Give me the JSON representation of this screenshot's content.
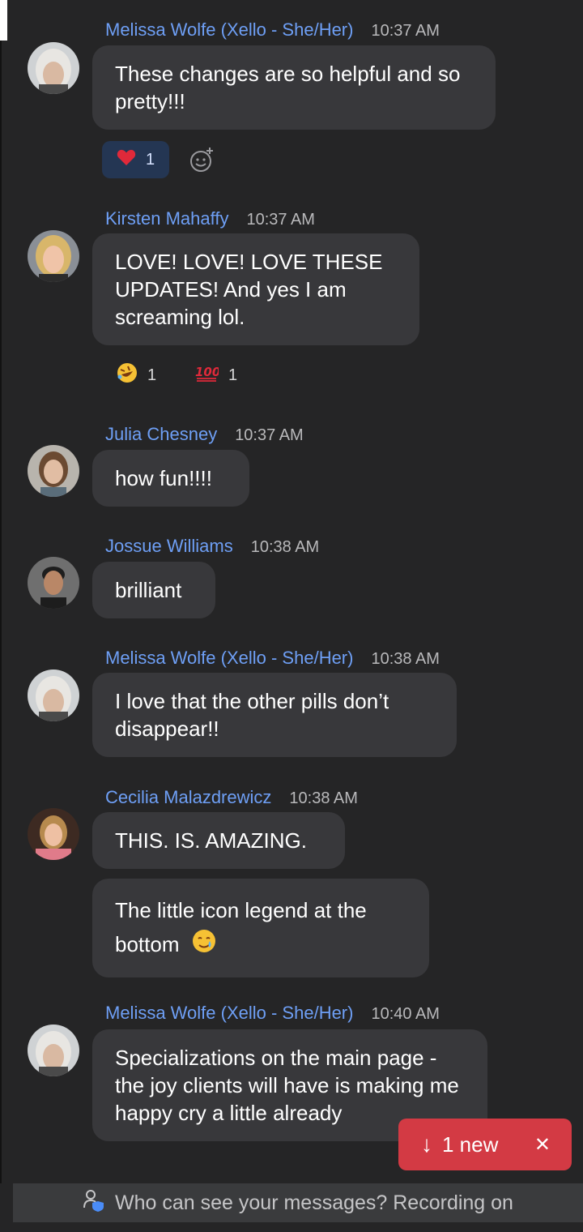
{
  "messages": [
    {
      "sender": "Melissa Wolfe (Xello - She/Her)",
      "time": "10:37 AM",
      "bubbles": [
        "These changes are so helpful and so pretty!!!"
      ],
      "reactions": [
        {
          "emoji": "heart",
          "count": "1"
        }
      ]
    },
    {
      "sender": "Kirsten Mahaffy",
      "time": "10:37 AM",
      "bubbles": [
        "LOVE! LOVE! LOVE THESE UPDATES! And yes I am screaming lol."
      ],
      "reactions": [
        {
          "emoji": "rolling-laughing",
          "count": "1"
        },
        {
          "emoji": "hundred",
          "count": "1"
        }
      ]
    },
    {
      "sender": "Julia Chesney",
      "time": "10:37 AM",
      "bubbles": [
        "how fun!!!!"
      ]
    },
    {
      "sender": "Jossue Williams",
      "time": "10:38 AM",
      "bubbles": [
        "brilliant"
      ]
    },
    {
      "sender": "Melissa Wolfe (Xello - She/Her)",
      "time": "10:38 AM",
      "bubbles": [
        "I love that the other pills don’t disappear!!"
      ]
    },
    {
      "sender": "Cecilia Malazdrewicz",
      "time": "10:38 AM",
      "bubbles": [
        "THIS. IS. AMAZING.",
        "The little icon legend at the bottom"
      ]
    },
    {
      "sender": "Melissa Wolfe (Xello - She/Her)",
      "time": "10:40 AM",
      "bubbles": [
        "Specializations on the main page - the joy clients will have is making me happy cry a little already"
      ]
    }
  ],
  "new_banner": {
    "arrow": "↓",
    "label": "1 new",
    "close": "✕"
  },
  "footer": {
    "text": "Who can see your messages? Recording on"
  },
  "colors": {
    "background": "#252526",
    "bubble": "#38383b",
    "name": "#6e9ff5",
    "new_banner": "#d33a44"
  }
}
